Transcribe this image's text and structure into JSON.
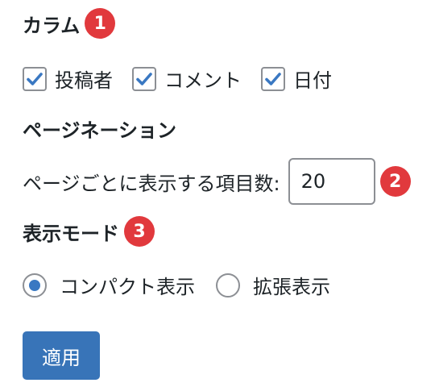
{
  "colors": {
    "accent": "#3874b8",
    "badge": "#e1393d",
    "text": "#1d2327",
    "border": "#8c8f94"
  },
  "columns": {
    "title": "カラム",
    "badge": "1",
    "items": [
      {
        "label": "投稿者",
        "checked": true
      },
      {
        "label": "コメント",
        "checked": true
      },
      {
        "label": "日付",
        "checked": true
      }
    ]
  },
  "pagination": {
    "title": "ページネーション",
    "per_page_label": "ページごとに表示する項目数:",
    "per_page_value": "20",
    "badge": "2"
  },
  "view_mode": {
    "title": "表示モード",
    "badge": "3",
    "options": [
      {
        "label": "コンパクト表示",
        "selected": true
      },
      {
        "label": "拡張表示",
        "selected": false
      }
    ]
  },
  "apply_button": {
    "label": "適用"
  }
}
